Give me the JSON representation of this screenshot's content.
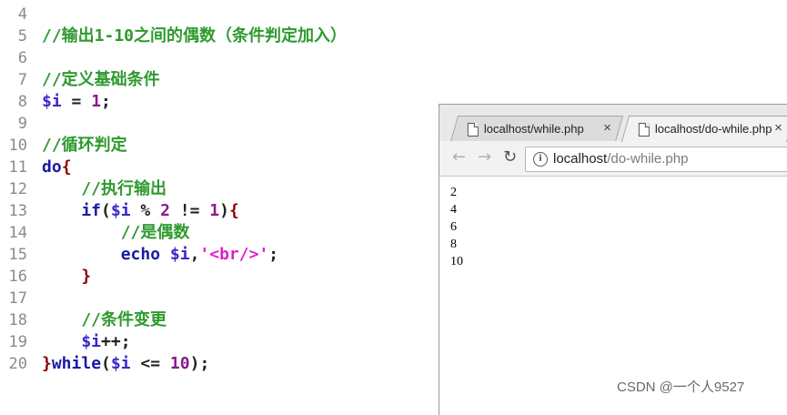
{
  "editor": {
    "lines": [
      {
        "n": "4"
      },
      {
        "n": "5",
        "parts": [
          {
            "t": "//输出1-10之间的偶数（条件判定加入）",
            "c": "comment"
          }
        ]
      },
      {
        "n": "6"
      },
      {
        "n": "7",
        "parts": [
          {
            "t": "//定义基础条件",
            "c": "comment"
          }
        ]
      },
      {
        "n": "8",
        "parts": [
          {
            "t": "$i",
            "c": "var"
          },
          {
            "t": " = ",
            "c": "op"
          },
          {
            "t": "1",
            "c": "num"
          },
          {
            "t": ";",
            "c": "op"
          }
        ]
      },
      {
        "n": "9"
      },
      {
        "n": "10",
        "parts": [
          {
            "t": "//循环判定",
            "c": "comment"
          }
        ]
      },
      {
        "n": "11",
        "parts": [
          {
            "t": "do",
            "c": "kw"
          },
          {
            "t": "{",
            "c": "brace"
          }
        ]
      },
      {
        "n": "12",
        "parts": [
          {
            "t": "    //执行输出",
            "c": "comment"
          }
        ]
      },
      {
        "n": "13",
        "parts": [
          {
            "t": "    if",
            "c": "kw"
          },
          {
            "t": "(",
            "c": "op"
          },
          {
            "t": "$i",
            "c": "var"
          },
          {
            "t": " % ",
            "c": "op"
          },
          {
            "t": "2",
            "c": "num"
          },
          {
            "t": " != ",
            "c": "op"
          },
          {
            "t": "1",
            "c": "num"
          },
          {
            "t": ")",
            "c": "op"
          },
          {
            "t": "{",
            "c": "brace"
          }
        ]
      },
      {
        "n": "14",
        "parts": [
          {
            "t": "        //是偶数",
            "c": "comment"
          }
        ]
      },
      {
        "n": "15",
        "parts": [
          {
            "t": "        echo ",
            "c": "kw"
          },
          {
            "t": "$i",
            "c": "var"
          },
          {
            "t": ",",
            "c": "op"
          },
          {
            "t": "'<br/>'",
            "c": "str"
          },
          {
            "t": ";",
            "c": "op"
          }
        ]
      },
      {
        "n": "16",
        "parts": [
          {
            "t": "    }",
            "c": "brace"
          }
        ]
      },
      {
        "n": "17"
      },
      {
        "n": "18",
        "parts": [
          {
            "t": "    //条件变更",
            "c": "comment"
          }
        ]
      },
      {
        "n": "19",
        "parts": [
          {
            "t": "    $i",
            "c": "var"
          },
          {
            "t": "++;",
            "c": "op"
          }
        ]
      },
      {
        "n": "20",
        "parts": [
          {
            "t": "}",
            "c": "brace"
          },
          {
            "t": "while",
            "c": "kw"
          },
          {
            "t": "(",
            "c": "op"
          },
          {
            "t": "$i",
            "c": "var"
          },
          {
            "t": " <= ",
            "c": "op"
          },
          {
            "t": "10",
            "c": "num"
          },
          {
            "t": ");",
            "c": "op"
          }
        ]
      }
    ]
  },
  "browser": {
    "tabs": [
      {
        "title": "localhost/while.php",
        "close": "×",
        "icon": "page-icon"
      },
      {
        "title": "localhost/do-while.php",
        "close": "×",
        "icon": "page-icon"
      }
    ],
    "nav": {
      "back": "←",
      "forward": "→",
      "reload": "↻"
    },
    "address": {
      "host": "localhost",
      "path": "/do-while.php",
      "icon": "info-icon"
    },
    "output": [
      "2",
      "4",
      "6",
      "8",
      "10"
    ]
  },
  "watermark": "CSDN @一个人9527",
  "colors": {
    "comment": "#2e9a2e",
    "variable": "#3a28c8",
    "number": "#8b1a8b",
    "keyword": "#1a1aa6",
    "string": "#e020c8",
    "brace": "#8b0000"
  }
}
